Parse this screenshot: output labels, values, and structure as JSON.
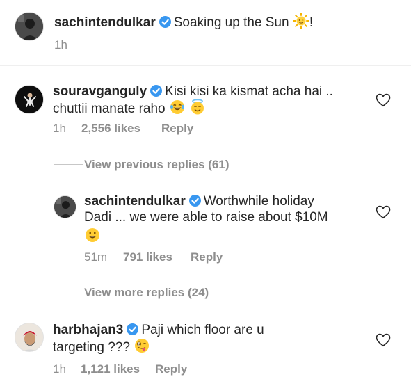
{
  "post": {
    "username": "sachintendulkar",
    "caption": "Soaking up the Sun",
    "trail": "!",
    "time": "1h"
  },
  "comments": [
    {
      "username": "souravganguly",
      "line1": "Kisi kisi ka kismat acha hai ..",
      "line2": "chuttii manate raho",
      "time": "1h",
      "likes": "2,556 likes",
      "reply": "Reply",
      "view_previous": "View previous replies (61)"
    },
    {
      "username": "sachintendulkar",
      "line1": "Worthwhile holiday",
      "line2": "Dadi ... we were able to raise about $10M",
      "time": "51m",
      "likes": "791 likes",
      "reply": "Reply",
      "view_more": "View more replies (24)"
    },
    {
      "username": "harbhajan3",
      "line1": "Paji which floor are u",
      "line2": "targeting ???",
      "time": "1h",
      "likes": "1,121 likes",
      "reply": "Reply"
    }
  ],
  "icons": {
    "verified": "verified-badge-icon",
    "like": "heart-icon",
    "sun": "sun-emoji",
    "laugh": "tears-of-joy-emoji",
    "halo": "smiling-halo-emoji",
    "smile": "grinning-emoji",
    "wink": "zany-face-emoji"
  },
  "colors": {
    "verified": "#3897f0",
    "meta": "#8e8e8e",
    "text": "#262626"
  }
}
